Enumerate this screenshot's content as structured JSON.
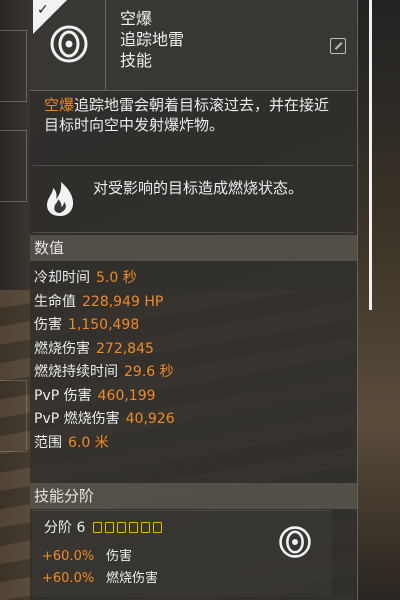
{
  "header": {
    "lines": [
      "空爆",
      "追踪地雷",
      "技能"
    ]
  },
  "description": {
    "highlight": "空爆",
    "text": "追踪地雷会朝着目标滚过去，并在接近目标时向空中发射爆炸物。"
  },
  "effect": {
    "text": "对受影响的目标造成燃烧状态。"
  },
  "stats_section": {
    "title": "数值",
    "rows": [
      {
        "label": "冷却时间",
        "value": "5.0 秒"
      },
      {
        "label": "生命值",
        "value": "228,949 HP"
      },
      {
        "label": "伤害",
        "value": "1,150,498"
      },
      {
        "label": "燃烧伤害",
        "value": "272,845"
      },
      {
        "label": "燃烧持续时间",
        "value": "29.6 秒"
      },
      {
        "label": "PvP 伤害",
        "value": "460,199"
      },
      {
        "label": "PvP 燃烧伤害",
        "value": "40,926"
      },
      {
        "label": "范围",
        "value": "6.0 米"
      }
    ]
  },
  "tier_section": {
    "title": "技能分阶",
    "tier_label": "分阶 6",
    "pips": 6,
    "bonuses": [
      {
        "value": "+60.0%",
        "label": "伤害"
      },
      {
        "value": "+60.0%",
        "label": "燃烧伤害"
      }
    ]
  },
  "colors": {
    "accent": "#f08a24",
    "tier_pip": "#e6b800"
  },
  "icons": {
    "header_icon": "seeker-mine-icon",
    "effect_icon": "burn-icon",
    "corner_icon": "check-icon",
    "pin_icon": "pin-icon"
  }
}
